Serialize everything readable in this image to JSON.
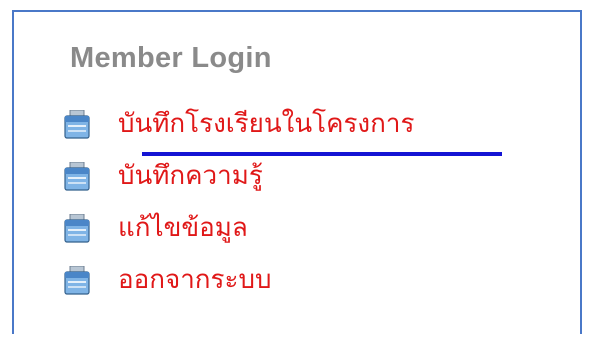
{
  "login_box": {
    "title": "Member Login",
    "border_color": "#4a78c8",
    "active_underline_color": "#1414d4",
    "items": [
      {
        "label": "บันทึกโรงเรียนในโครงการ",
        "icon": "window-icon",
        "active": true
      },
      {
        "label": "บันทึกความรู้",
        "icon": "window-icon",
        "active": false
      },
      {
        "label": "แก้ไขข้อมูล",
        "icon": "window-icon",
        "active": false
      },
      {
        "label": "ออกจากระบบ",
        "icon": "window-icon",
        "active": false
      }
    ]
  }
}
